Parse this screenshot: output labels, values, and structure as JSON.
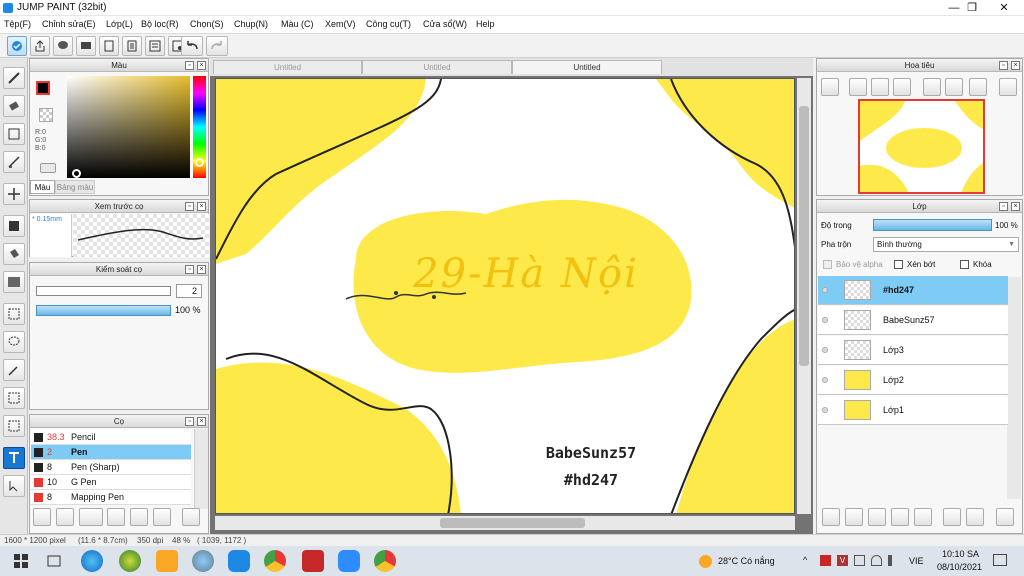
{
  "window": {
    "title": "JUMP PAINT (32bit)",
    "min": "—",
    "max": "❐",
    "close": "✕"
  },
  "menu": [
    "Tệp(F)",
    "Chỉnh sửa(E)",
    "Lớp(L)",
    "Bộ lọc(R)",
    "Chọn(S)",
    "Chụp(N)",
    "Màu (C)",
    "Xem(V)",
    "Công cụ(T)",
    "Cửa sổ(W)",
    "Help"
  ],
  "color_panel": {
    "title": "Màu",
    "r": "R:0",
    "g": "G:0",
    "b": "B:0",
    "tab_color": "Màu",
    "tab_palette": "Bảng màu",
    "hue_accent": "#ffd400"
  },
  "preview_panel": {
    "title": "Xem trước cọ",
    "size": "* 0.15mm"
  },
  "control_panel": {
    "title": "Kiểm soát cọ",
    "size_value": "2",
    "opacity": "100 %"
  },
  "brush_panel": {
    "title": "Cọ",
    "items": [
      {
        "size": "38.3",
        "name": "Pencil",
        "color": "#222222"
      },
      {
        "size": "2",
        "name": "Pen",
        "color": "#222222"
      },
      {
        "size": "8",
        "name": "Pen (Sharp)",
        "color": "#222222"
      },
      {
        "size": "10",
        "name": "G Pen",
        "color": "#e53935"
      },
      {
        "size": "8",
        "name": "Mapping Pen",
        "color": "#e53935"
      }
    ]
  },
  "tabs": [
    "Untitled",
    "Untitled",
    "Untitled"
  ],
  "canvas": {
    "title": "29-Hà Nội",
    "signature1": "BabeSunz57",
    "signature2": "#hd247",
    "accent": "#fde94a"
  },
  "nav_panel": {
    "title": "Hoa tiêu"
  },
  "layer_panel": {
    "title": "Lớp",
    "opacity_label": "Độ trong",
    "opacity_value": "100 %",
    "blend_label": "Pha trộn",
    "blend_value": "Bình thường",
    "protect_alpha": "Bảo vệ alpha",
    "clip": "Xén bớt",
    "lock": "Khóa",
    "layers": [
      "#hd247",
      "BabeSunz57",
      "Lớp3",
      "Lớp2",
      "Lớp1"
    ]
  },
  "status": {
    "size": "1600 * 1200 pixel",
    "cm": "(11.6 * 8.7cm)",
    "dpi": "350 dpi",
    "zoom": "48 %",
    "coords": "( 1039, 1172 )"
  },
  "taskbar": {
    "weather": "28°C Có nắng",
    "lang": "VIE",
    "time": "10:10 SA",
    "date": "08/10/2021"
  }
}
